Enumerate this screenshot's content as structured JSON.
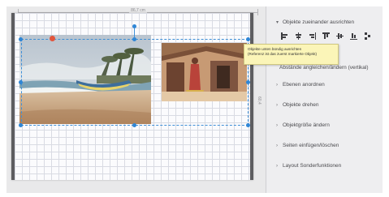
{
  "ruler": {
    "top_label": "86,7 cm",
    "side_label": "60,4"
  },
  "tooltip": {
    "line1": "Objekte unten bündig ausrichten",
    "line2": "(Referenz ist das zuerst markierte Objekt)"
  },
  "panel": {
    "items": [
      {
        "label": "Objekte zueinander ausrichten",
        "expanded": true
      },
      {
        "label": "Ebenen anordnen",
        "expanded": false
      },
      {
        "label": "Objekte drehen",
        "expanded": false
      },
      {
        "label": "Objektgröße ändern",
        "expanded": false
      },
      {
        "label": "Seiten einfügen/löschen",
        "expanded": false
      },
      {
        "label": "Layout Sonderfunktionen",
        "expanded": false
      }
    ],
    "partially_hidden_text": "Abstände angleichen/ändern (vertikal)",
    "align_icons": [
      "align-left-icon",
      "align-center-icon",
      "align-right-icon",
      "align-top-icon",
      "align-middle-icon",
      "align-bottom-icon",
      "distribute-icon"
    ]
  },
  "colors": {
    "selection": "#3f8fd6",
    "rotate_handle": "#e2553c",
    "tooltip_bg": "#fbf5b8"
  }
}
